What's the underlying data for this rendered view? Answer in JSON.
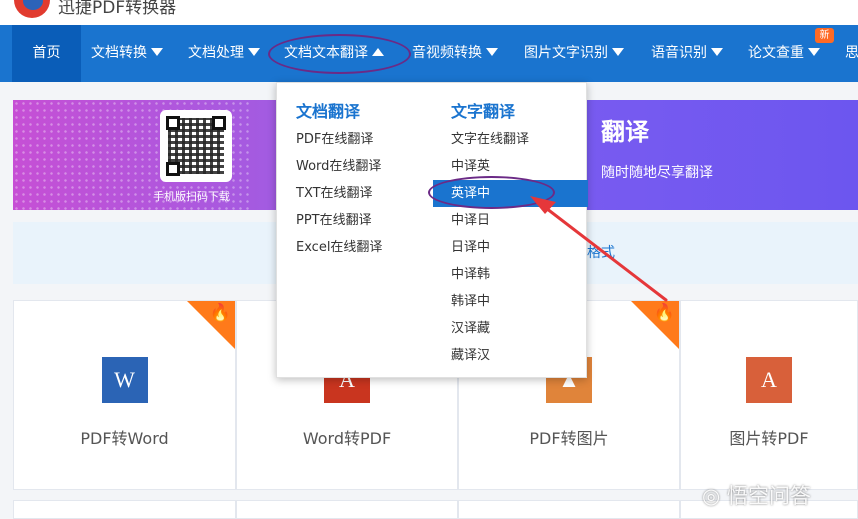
{
  "header": {
    "brand": "迅捷PDF转换器"
  },
  "nav": {
    "items": [
      {
        "label": "首页"
      },
      {
        "label": "文档转换"
      },
      {
        "label": "文档处理"
      },
      {
        "label": "文档文本翻译"
      },
      {
        "label": "音视频转换"
      },
      {
        "label": "图片文字识别"
      },
      {
        "label": "语音识别"
      },
      {
        "label": "论文查重"
      },
      {
        "label": "思"
      }
    ],
    "new_badge": "新"
  },
  "banner": {
    "qr_caption": "手机版扫码下载",
    "title_fragment": "翻译",
    "sub_fragment": "随时随地尽享翻译"
  },
  "strip": {
    "text_fragment": "格式"
  },
  "dropdown": {
    "doc_heading": "文档翻译",
    "doc_items": [
      "PDF在线翻译",
      "Word在线翻译",
      "TXT在线翻译",
      "PPT在线翻译",
      "Excel在线翻译"
    ],
    "text_heading": "文字翻译",
    "text_items": [
      "文字在线翻译",
      "中译英",
      "英译中",
      "中译日",
      "日译中",
      "中译韩",
      "韩译中",
      "汉译藏",
      "藏译汉"
    ],
    "selected": "英译中"
  },
  "cards": [
    {
      "label": "PDF转Word",
      "icon": "word-icon",
      "glyph": "W",
      "color": "#2b64b5",
      "hot": true
    },
    {
      "label": "Word转PDF",
      "icon": "pdf-icon",
      "glyph": "A",
      "color": "#c9351f",
      "hot": false
    },
    {
      "label": "PDF转图片",
      "icon": "image-icon",
      "glyph": "▲",
      "color": "#e0843a",
      "hot": true
    },
    {
      "label": "图片转PDF",
      "icon": "pdf-icon",
      "glyph": "A",
      "color": "#d8603a",
      "hot": false
    }
  ],
  "watermark": "悟空问答",
  "colors": {
    "nav_bg": "#1a74cf",
    "accent": "#1a74cf",
    "annotation": "#6b2a86",
    "arrow": "#e5373a",
    "hot": "#ff7a1a"
  }
}
